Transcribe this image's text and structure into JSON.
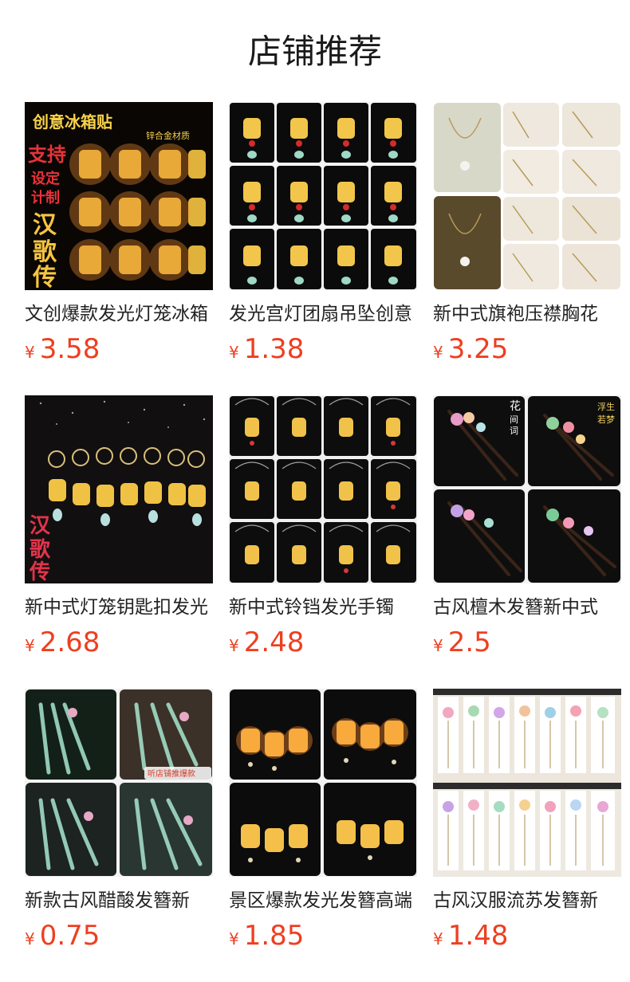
{
  "header": {
    "title": "店铺推荐"
  },
  "colors": {
    "price": "#ee3f20",
    "title_text": "#1a1a1a",
    "name_text": "#222222"
  },
  "products": [
    {
      "name": "文创爆款发光灯笼冰箱",
      "currency": "¥",
      "price": "3.58",
      "image_text": {
        "line1": "创意冰箱贴",
        "line2": "锌合金材质",
        "line3": "支持",
        "line4": "设定",
        "line5": "计制",
        "line6": "汉",
        "line7": "歌",
        "line8": "传"
      }
    },
    {
      "name": "发光宫灯团扇吊坠创意",
      "currency": "¥",
      "price": "1.38"
    },
    {
      "name": "新中式旗袍压襟胸花",
      "currency": "¥",
      "price": "3.25"
    },
    {
      "name": "新中式灯笼钥匙扣发光",
      "currency": "¥",
      "price": "2.68",
      "image_text": {
        "line1": "汉",
        "line2": "歌",
        "line3": "传"
      }
    },
    {
      "name": "新中式铃铛发光手镯",
      "currency": "¥",
      "price": "2.48"
    },
    {
      "name": "古风檀木发簪新中式",
      "currency": "¥",
      "price": "2.5",
      "image_text": {
        "line1": "花",
        "line2": "间",
        "line3": "词",
        "line4": "浮生",
        "line5": "若梦"
      }
    },
    {
      "name": "新款古风醋酸发簪新",
      "currency": "¥",
      "price": "0.75",
      "image_text": {
        "line1": "听店铺推爆款"
      }
    },
    {
      "name": "景区爆款发光发簪高端",
      "currency": "¥",
      "price": "1.85"
    },
    {
      "name": "古风汉服流苏发簪新",
      "currency": "¥",
      "price": "1.48"
    }
  ]
}
